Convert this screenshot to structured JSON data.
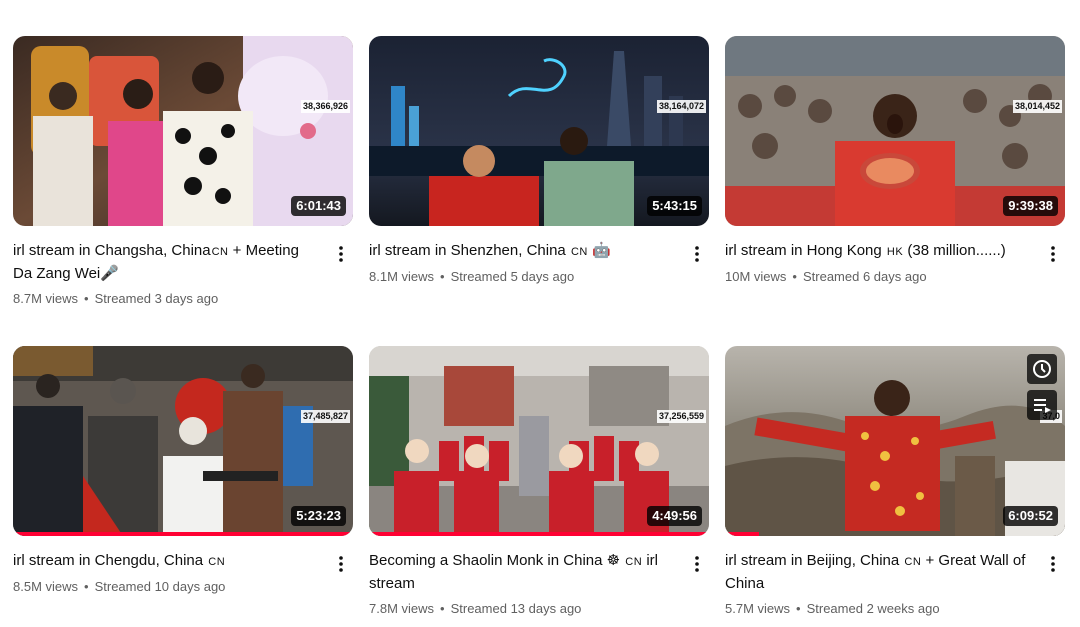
{
  "videos": [
    {
      "title": "irl stream in Changsha, China",
      "country": "CN",
      "title_suffix": " + Meeting Da Zang Wei",
      "emoji": "🎤",
      "views": "8.7M views",
      "streamed": "Streamed 3 days ago",
      "duration": "6:01:43",
      "viewer_count": "38,366,926",
      "progress": 0
    },
    {
      "title": "irl stream in Shenzhen, China",
      "country": "CN",
      "title_suffix": "",
      "emoji": "🤖",
      "views": "8.1M views",
      "streamed": "Streamed 5 days ago",
      "duration": "5:43:15",
      "viewer_count": "38,164,072",
      "progress": 0
    },
    {
      "title": "irl stream in Hong Kong",
      "country": "HK",
      "title_suffix": " (38 million......)",
      "emoji": "",
      "views": "10M views",
      "streamed": "Streamed 6 days ago",
      "duration": "9:39:38",
      "viewer_count": "38,014,452",
      "progress": 0
    },
    {
      "title": "irl stream in Chengdu, China",
      "country": "CN",
      "title_suffix": "",
      "emoji": "",
      "views": "8.5M views",
      "streamed": "Streamed 10 days ago",
      "duration": "5:23:23",
      "viewer_count": "37,485,827",
      "progress": 1.0
    },
    {
      "title": "Becoming a Shaolin Monk in China",
      "country": "CN",
      "title_suffix": " irl stream",
      "emoji": "☸",
      "views": "7.8M views",
      "streamed": "Streamed 13 days ago",
      "duration": "4:49:56",
      "viewer_count": "37,256,559",
      "progress": 1.0
    },
    {
      "title": "irl stream in Beijing, China",
      "country": "CN",
      "title_suffix": " + Great Wall of China",
      "emoji": "",
      "views": "5.7M views",
      "streamed": "Streamed 2 weeks ago",
      "duration": "6:09:52",
      "viewer_count": "37,0",
      "progress": 0.1
    }
  ],
  "overlay": {
    "watch_later_icon": "clock-icon",
    "add_to_queue_icon": "queue-icon"
  },
  "colors": {
    "progress": "#ff0033",
    "text_primary": "#0f0f0f",
    "text_secondary": "#606060"
  }
}
